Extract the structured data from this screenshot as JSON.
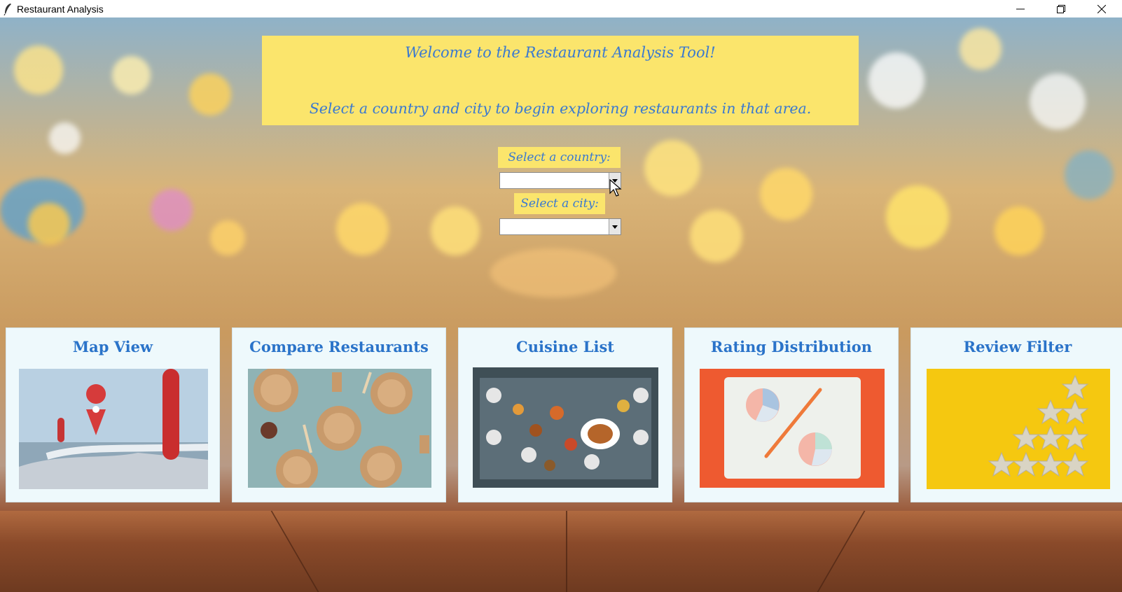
{
  "window": {
    "title": "Restaurant Analysis",
    "app_icon": "feather-icon",
    "controls": [
      "minimize-icon",
      "restore-icon",
      "close-icon"
    ]
  },
  "banner": {
    "line1": "Welcome to the Restaurant Analysis Tool!",
    "line2": "Select a country and city to begin exploring restaurants in that area."
  },
  "filters": {
    "country_label": "Select a country:",
    "country_value": "",
    "city_label": "Select a city:",
    "city_value": ""
  },
  "cards": [
    {
      "title": "Map View",
      "icon": "map-pin-image"
    },
    {
      "title": "Compare Restaurants",
      "icon": "plates-image"
    },
    {
      "title": "Cuisine List",
      "icon": "dinner-table-image"
    },
    {
      "title": "Rating Distribution",
      "icon": "pie-chart-image"
    },
    {
      "title": "Review Filter",
      "icon": "stars-image"
    }
  ],
  "colors": {
    "banner_bg": "#fbe56c",
    "accent_text": "#3a79d0",
    "card_bg": "#eef9fc",
    "card_title": "#2a73c9"
  }
}
